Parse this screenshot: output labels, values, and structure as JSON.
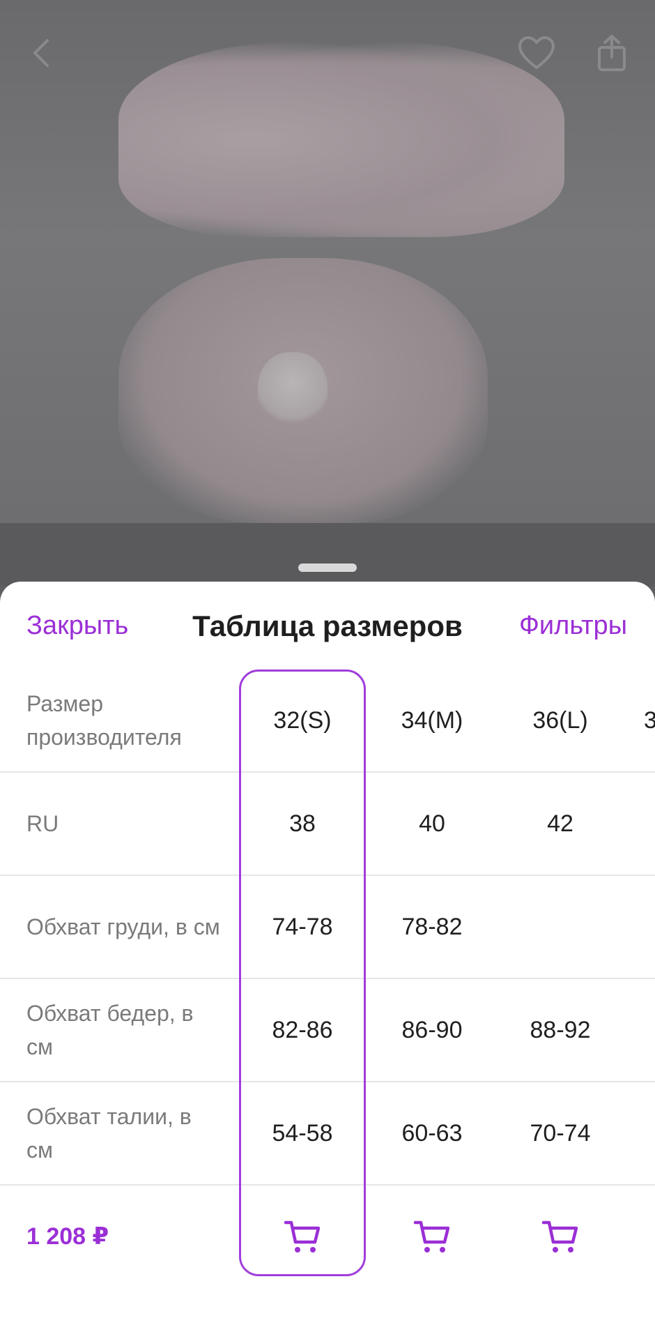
{
  "header": {
    "close_label": "Закрыть",
    "title": "Таблица размеров",
    "filters_label": "Фильтры"
  },
  "columns": [
    "32(S)",
    "34(M)",
    "36(L)",
    "3"
  ],
  "rows": [
    {
      "label": "Размер производителя",
      "values": [
        "32(S)",
        "34(M)",
        "36(L)",
        "3"
      ]
    },
    {
      "label": "RU",
      "values": [
        "38",
        "40",
        "42",
        ""
      ]
    },
    {
      "label": "Обхват груди, в см",
      "values": [
        "74-78",
        "78-82",
        "",
        ""
      ]
    },
    {
      "label": "Обхват бедер, в см",
      "values": [
        "82-86",
        "86-90",
        "88-92",
        ""
      ]
    },
    {
      "label": "Обхват талии, в см",
      "values": [
        "54-58",
        "60-63",
        "70-74",
        ""
      ]
    }
  ],
  "footer": {
    "price": "1 208 ₽"
  },
  "selected_column": "32(S)",
  "colors": {
    "accent": "#9b2fd6",
    "text": "#1f1f1f",
    "muted": "#7a7a7a"
  },
  "icons": {
    "back": "chevron-left-icon",
    "favorite": "heart-icon",
    "share": "share-icon",
    "cart": "cart-icon"
  }
}
